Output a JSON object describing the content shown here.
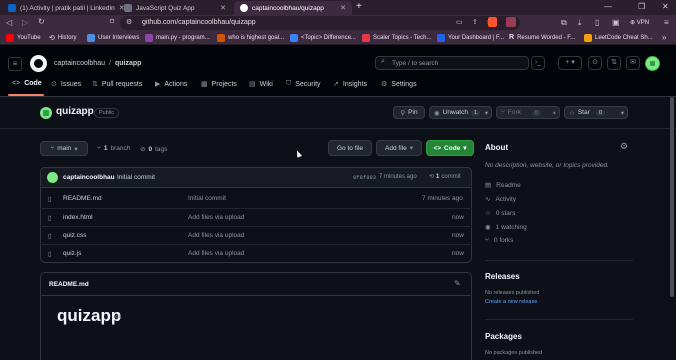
{
  "browser": {
    "tabs": [
      {
        "title": "(1) Activity | pratik patil | LinkedIn",
        "color": "#0a66c2"
      },
      {
        "title": "JavaScript Quiz App",
        "color": "#6b7280"
      },
      {
        "title": "captaincoolbhau/quizapp",
        "color": "#ffffff"
      }
    ],
    "new_tab": "+",
    "url": "github.com/captaincoolbhau/quizapp",
    "vpn": "VPN",
    "bookmarks": [
      {
        "label": "YouTube",
        "color": "#ff0000"
      },
      {
        "label": "History",
        "color": "#cfc3cd"
      },
      {
        "label": "User Interviews",
        "color": "#4a90e2"
      },
      {
        "label": "main.py - program...",
        "color": "#8e44ad"
      },
      {
        "label": "who is highest goal...",
        "color": "#d35400"
      },
      {
        "label": "<Topic> Difference...",
        "color": "#3b82f6"
      },
      {
        "label": "Scaler Topics - Tech...",
        "color": "#e63946"
      },
      {
        "label": "Your Dashboard | F...",
        "color": "#2563eb"
      },
      {
        "label": "Resume Worded - F...",
        "color": "#ffffff"
      },
      {
        "label": "LeetCode Cheat Sh...",
        "color": "#f59e0b"
      }
    ]
  },
  "header": {
    "owner": "captaincoolbhau",
    "slash": "/",
    "repo": "quizapp",
    "search_placeholder": "Type / to search",
    "tabs": [
      {
        "label": "Code",
        "icon": "code-icon"
      },
      {
        "label": "Issues",
        "icon": "issue-icon"
      },
      {
        "label": "Pull requests",
        "icon": "pr-icon"
      },
      {
        "label": "Actions",
        "icon": "play-icon"
      },
      {
        "label": "Projects",
        "icon": "table-icon"
      },
      {
        "label": "Wiki",
        "icon": "book-icon"
      },
      {
        "label": "Security",
        "icon": "shield-icon"
      },
      {
        "label": "Insights",
        "icon": "graph-icon"
      },
      {
        "label": "Settings",
        "icon": "gear-icon"
      }
    ]
  },
  "repo": {
    "name": "quizapp",
    "visibility": "Public",
    "pin": "Pin",
    "unwatch": "Unwatch",
    "watch_count": "1",
    "fork": "Fork",
    "fork_count": "0",
    "star": "Star",
    "star_count": "0"
  },
  "branch_bar": {
    "branch": "main",
    "branch_count": "1",
    "branch_label": "branch",
    "tag_count": "0",
    "tag_label": "tags",
    "go_to_file": "Go to file",
    "add_file": "Add file",
    "code": "Code"
  },
  "commit": {
    "author": "captaincoolbhau",
    "message": "Initial commit",
    "hash": "9f8f893",
    "time": "7 minutes ago",
    "count": "1",
    "count_label": "commit"
  },
  "files": [
    {
      "name": "README.md",
      "message": "Initial commit",
      "time": "7 minutes ago"
    },
    {
      "name": "index.html",
      "message": "Add files via upload",
      "time": "now"
    },
    {
      "name": "quiz.css",
      "message": "Add files via upload",
      "time": "now"
    },
    {
      "name": "quiz.js",
      "message": "Add files via upload",
      "time": "now"
    }
  ],
  "readme": {
    "filename": "README.md",
    "heading": "quizapp"
  },
  "about": {
    "title": "About",
    "description": "No description, website, or topics provided.",
    "readme": "Readme",
    "activity": "Activity",
    "stars": "0 stars",
    "watching": "1 watching",
    "forks": "0 forks"
  },
  "releases": {
    "title": "Releases",
    "none": "No releases published",
    "create": "Create a new release"
  },
  "packages": {
    "title": "Packages",
    "none": "No packages published"
  },
  "colors": {
    "accent_green": "#238636",
    "link_blue": "#58a6ff",
    "tab_underline": "#f78166"
  }
}
